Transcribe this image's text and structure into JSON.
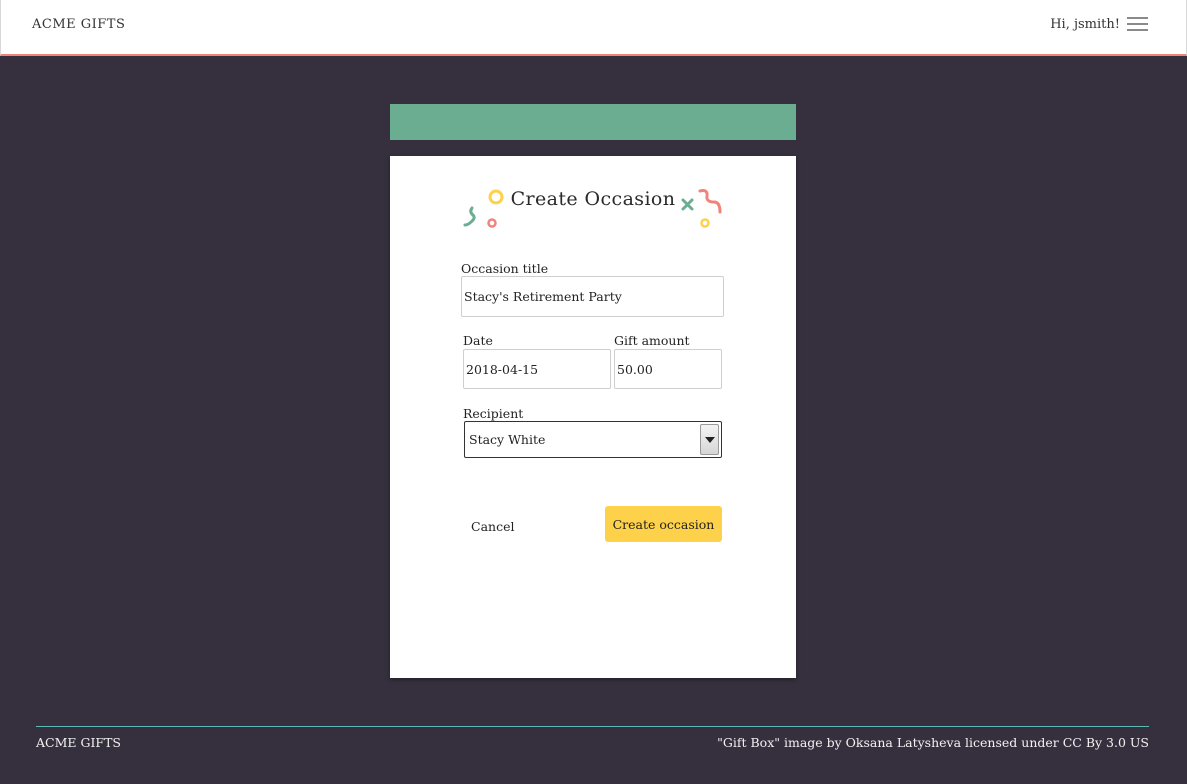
{
  "header": {
    "brand": "ACME GIFTS",
    "greeting": "Hi, jsmith!",
    "menu_icon": "hamburger-menu-icon"
  },
  "colors": {
    "banner": "#6aad91",
    "accent_line": "#f0847c",
    "primary_button": "#fdd14a",
    "background": "#36303e"
  },
  "form": {
    "title": "Create Occasion",
    "occasion_title_label": "Occasion title",
    "occasion_title_value": "Stacy's Retirement Party",
    "date_label": "Date",
    "date_value": "2018-04-15",
    "gift_amount_label": "Gift amount",
    "gift_amount_value": "50.00",
    "recipient_label": "Recipient",
    "recipient_value": "Stacy White",
    "cancel_label": "Cancel",
    "create_label": "Create occasion"
  },
  "footer": {
    "brand": "ACME GIFTS",
    "credit": "\"Gift Box\" image by Oksana Latysheva licensed under CC By 3.0 US"
  }
}
